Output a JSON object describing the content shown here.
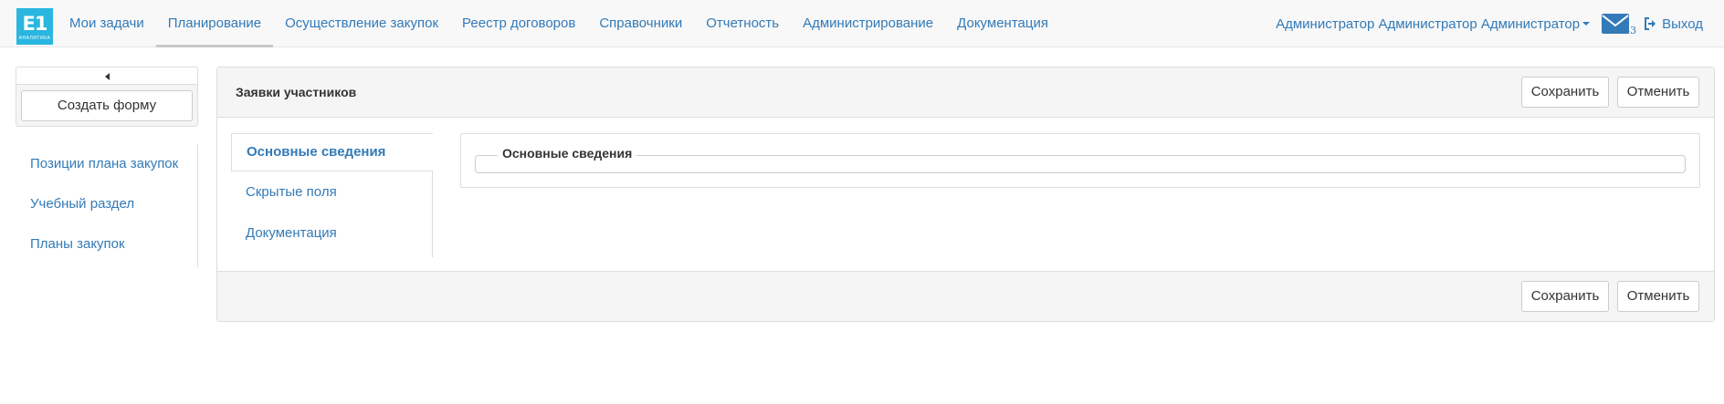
{
  "app": {
    "logo_text": "E1",
    "logo_sub": "АНАЛИТИКА"
  },
  "nav": {
    "items": [
      {
        "label": "Мои задачи",
        "active": false
      },
      {
        "label": "Планирование",
        "active": true
      },
      {
        "label": "Осуществление закупок",
        "active": false
      },
      {
        "label": "Реестр договоров",
        "active": false
      },
      {
        "label": "Справочники",
        "active": false
      },
      {
        "label": "Отчетность",
        "active": false
      },
      {
        "label": "Администрирование",
        "active": false
      },
      {
        "label": "Документация",
        "active": false
      }
    ],
    "user": "Администратор Администратор Администратор",
    "mail_count": "43",
    "logout": "Выход"
  },
  "sidebar": {
    "create_form": "Создать форму",
    "items": [
      {
        "label": "Позиции плана закупок"
      },
      {
        "label": "Учебный раздел"
      },
      {
        "label": "Планы закупок"
      }
    ]
  },
  "panel": {
    "title": "Заявки участников",
    "save": "Сохранить",
    "cancel": "Отменить",
    "tabs": [
      {
        "label": "Основные сведения",
        "active": true
      },
      {
        "label": "Скрытые поля",
        "active": false
      },
      {
        "label": "Документация",
        "active": false
      }
    ],
    "fieldset_legend": "Основные сведения"
  },
  "colors": {
    "link": "#337ab7",
    "logo_bg": "#29b6e0",
    "panel_heading": "#f5f5f5"
  },
  "icons": [
    "envelope-icon",
    "logout-icon",
    "caret-left-icon",
    "caret-down-icon"
  ]
}
